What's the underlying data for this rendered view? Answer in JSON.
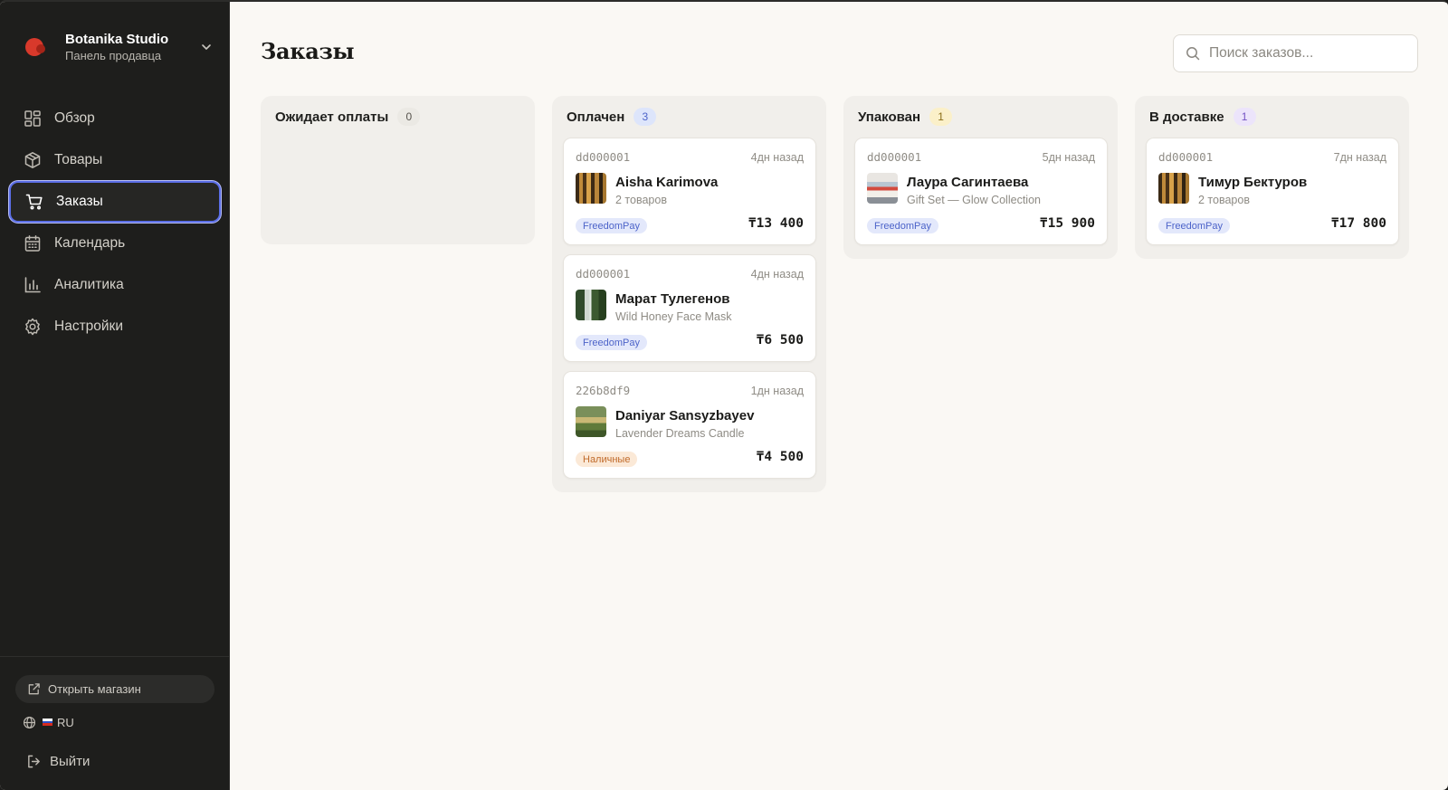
{
  "brand": {
    "name": "Botanika Studio",
    "subtitle": "Панель продавца"
  },
  "nav": [
    {
      "label": "Обзор",
      "icon": "grid-icon"
    },
    {
      "label": "Товары",
      "icon": "box-icon"
    },
    {
      "label": "Заказы",
      "icon": "cart-icon",
      "active": true
    },
    {
      "label": "Календарь",
      "icon": "calendar-icon"
    },
    {
      "label": "Аналитика",
      "icon": "bar-chart-icon"
    },
    {
      "label": "Настройки",
      "icon": "gear-icon"
    }
  ],
  "sidebar_footer": {
    "open_shop": "Открыть магазин",
    "lang": "RU",
    "logout": "Выйти"
  },
  "page": {
    "title": "Заказы"
  },
  "search": {
    "placeholder": "Поиск заказов..."
  },
  "colors": {
    "accent": "#5b6ee6",
    "brand_red": "#d8392b",
    "sidebar_bg": "#1e1e1c",
    "page_bg": "#faf8f4"
  },
  "columns": [
    {
      "title": "Ожидает оплаты",
      "count": "0",
      "count_bg": "#ebe9e4",
      "count_fg": "#55524c",
      "cards": []
    },
    {
      "title": "Оплачен",
      "count": "3",
      "count_bg": "#dde5fb",
      "count_fg": "#4c63c9",
      "cards": [
        {
          "id": "dd000001",
          "time": "4дн назад",
          "name": "Aisha Karimova",
          "sub": "2 товаров",
          "payment": "FreedomPay",
          "payment_type": "fp",
          "price": "₸13 400",
          "thumb": "forest"
        },
        {
          "id": "dd000001",
          "time": "4дн назад",
          "name": "Марат Тулегенов",
          "sub": "Wild Honey Face Mask",
          "payment": "FreedomPay",
          "payment_type": "fp",
          "price": "₸6 500",
          "thumb": "waterfall"
        },
        {
          "id": "226b8df9",
          "time": "1дн назад",
          "name": "Daniyar Sansyzbayev",
          "sub": "Lavender Dreams Candle",
          "payment": "Наличные",
          "payment_type": "cash",
          "price": "₸4 500",
          "thumb": "meadow"
        }
      ]
    },
    {
      "title": "Упакован",
      "count": "1",
      "count_bg": "#fbf0c9",
      "count_fg": "#8a6d16",
      "cards": [
        {
          "id": "dd000001",
          "time": "5дн назад",
          "name": "Лаура Сагинтаева",
          "sub": "Gift Set — Glow Collection",
          "payment": "FreedomPay",
          "payment_type": "fp",
          "price": "₸15 900",
          "thumb": "table"
        }
      ]
    },
    {
      "title": "В доставке",
      "count": "1",
      "count_bg": "#ece4fb",
      "count_fg": "#7453c4",
      "cards": [
        {
          "id": "dd000001",
          "time": "7дн назад",
          "name": "Тимур Бектуров",
          "sub": "2 товаров",
          "payment": "FreedomPay",
          "payment_type": "fp",
          "price": "₸17 800",
          "thumb": "forest"
        }
      ]
    }
  ]
}
